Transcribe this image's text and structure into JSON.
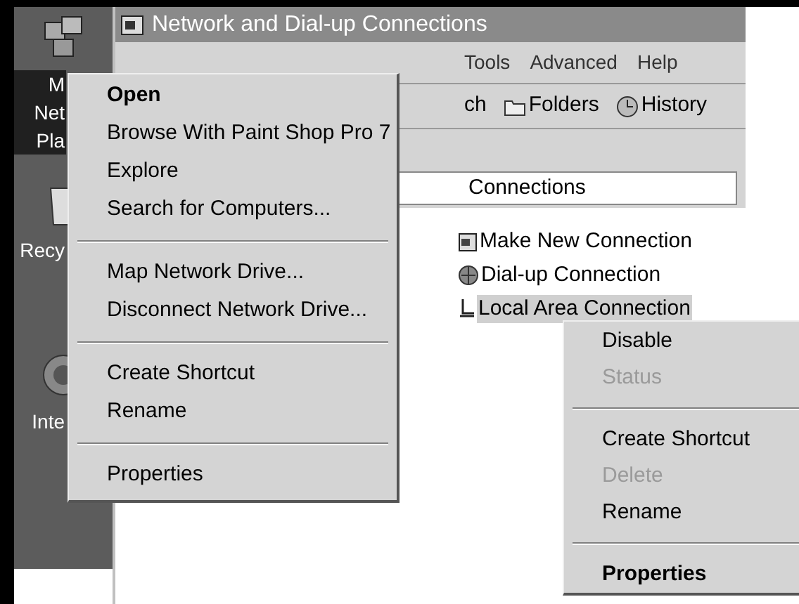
{
  "desktop_icons": [
    {
      "label_lines": [
        "M",
        "Net",
        "Pla"
      ],
      "selected": true
    },
    {
      "label_lines": [
        "Recy"
      ],
      "selected": false
    },
    {
      "label_lines": [
        "Inte"
      ],
      "selected": false
    }
  ],
  "window": {
    "title": "Network and Dial-up Connections",
    "menu": [
      "Tools",
      "Advanced",
      "Help"
    ],
    "toolbar": {
      "cut_label": "ch",
      "buttons": [
        "Folders",
        "History"
      ]
    },
    "address": "Connections",
    "items": [
      {
        "label": "Make New Connection",
        "selected": false
      },
      {
        "label": "Dial-up Connection",
        "selected": false
      },
      {
        "label": "Local Area Connection",
        "selected": true
      }
    ]
  },
  "context_menus": [
    {
      "items": [
        {
          "kind": "item",
          "label": "Open",
          "bold": true,
          "disabled": false
        },
        {
          "kind": "item",
          "label": "Browse With Paint Shop Pro 7",
          "bold": false,
          "disabled": false
        },
        {
          "kind": "item",
          "label": "Explore",
          "bold": false,
          "disabled": false
        },
        {
          "kind": "item",
          "label": "Search for Computers...",
          "bold": false,
          "disabled": false
        },
        {
          "kind": "separator"
        },
        {
          "kind": "item",
          "label": "Map Network Drive...",
          "bold": false,
          "disabled": false
        },
        {
          "kind": "item",
          "label": "Disconnect Network Drive...",
          "bold": false,
          "disabled": false
        },
        {
          "kind": "separator"
        },
        {
          "kind": "item",
          "label": "Create Shortcut",
          "bold": false,
          "disabled": false
        },
        {
          "kind": "item",
          "label": "Rename",
          "bold": false,
          "disabled": false
        },
        {
          "kind": "separator"
        },
        {
          "kind": "item",
          "label": "Properties",
          "bold": false,
          "disabled": false
        }
      ]
    },
    {
      "items": [
        {
          "kind": "item",
          "label": "Disable",
          "bold": false,
          "disabled": false
        },
        {
          "kind": "item",
          "label": "Status",
          "bold": false,
          "disabled": true
        },
        {
          "kind": "separator"
        },
        {
          "kind": "item",
          "label": "Create Shortcut",
          "bold": false,
          "disabled": false
        },
        {
          "kind": "item",
          "label": "Delete",
          "bold": false,
          "disabled": true
        },
        {
          "kind": "item",
          "label": "Rename",
          "bold": false,
          "disabled": false
        },
        {
          "kind": "separator"
        },
        {
          "kind": "item",
          "label": "Properties",
          "bold": true,
          "disabled": false
        }
      ]
    }
  ]
}
